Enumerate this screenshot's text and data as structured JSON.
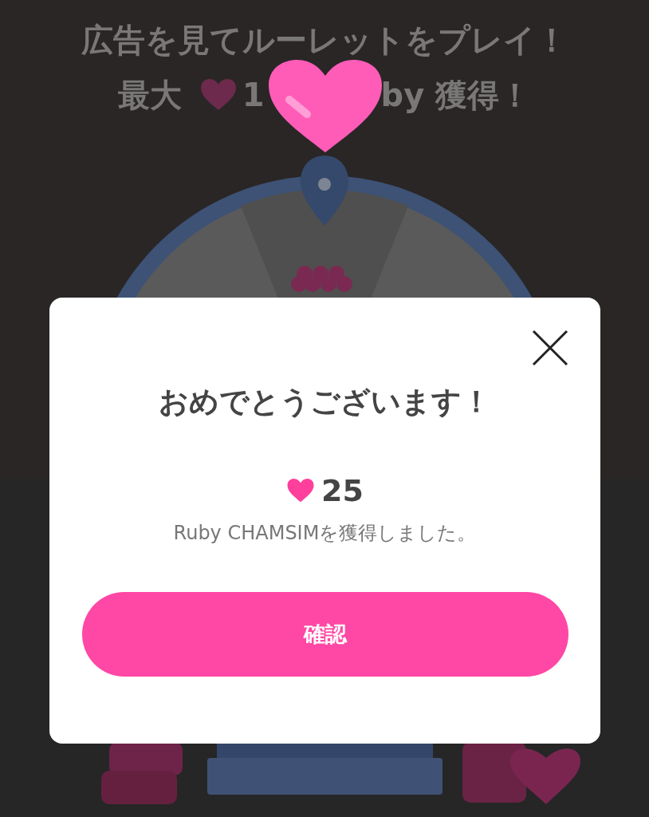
{
  "banner": {
    "headline": "広告を見てルーレットをプレイ！",
    "max_prefix": "最大",
    "max_digit": "1",
    "max_suffix": "by 獲得！"
  },
  "dialog": {
    "title": "おめでとうございます！",
    "reward_amount": "25",
    "message": "Ruby CHAMSIMを獲得しました。",
    "confirm_button": "確認"
  }
}
